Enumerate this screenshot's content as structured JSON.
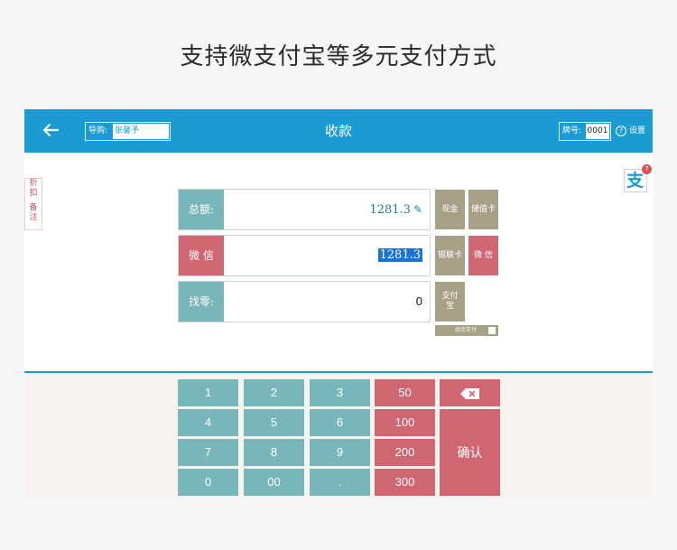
{
  "headline": "支持微支付宝等多元支付方式",
  "header": {
    "back_icon": "back-arrow-icon",
    "guide_label": "导购:",
    "guide_value": "张馨予",
    "title": "收款",
    "tag_label": "牌号:",
    "tag_value": "0001",
    "settings_icon": "help-circle-icon",
    "settings_label": "设置"
  },
  "side": {
    "discount": [
      "折",
      "扣"
    ],
    "note": [
      "备",
      "注"
    ]
  },
  "alipay_badge": {
    "icon": "alipay-icon",
    "glyph": "支",
    "count": "7"
  },
  "payment": {
    "total_label": "总额:",
    "total_value": "1281.3",
    "method_label": "微 信",
    "method_value": "1281.3",
    "change_label": "找零:",
    "change_value": "0"
  },
  "pay_methods": {
    "cash": "现金",
    "stored_card": "储值卡",
    "unionpay": "银联卡",
    "wechat": "微 信",
    "alipay": "支付宝",
    "combo": "组合支付"
  },
  "keypad": {
    "digits": [
      "1",
      "2",
      "3",
      "4",
      "5",
      "6",
      "7",
      "8",
      "9",
      "0",
      "00",
      "."
    ],
    "amounts": [
      "50",
      "100",
      "200",
      "300"
    ],
    "confirm": "确认",
    "backspace_icon": "backspace-icon"
  },
  "colors": {
    "primary": "#1a9bd2",
    "teal": "#79b6b9",
    "red": "#cf6672",
    "khaki": "#a89f87"
  }
}
